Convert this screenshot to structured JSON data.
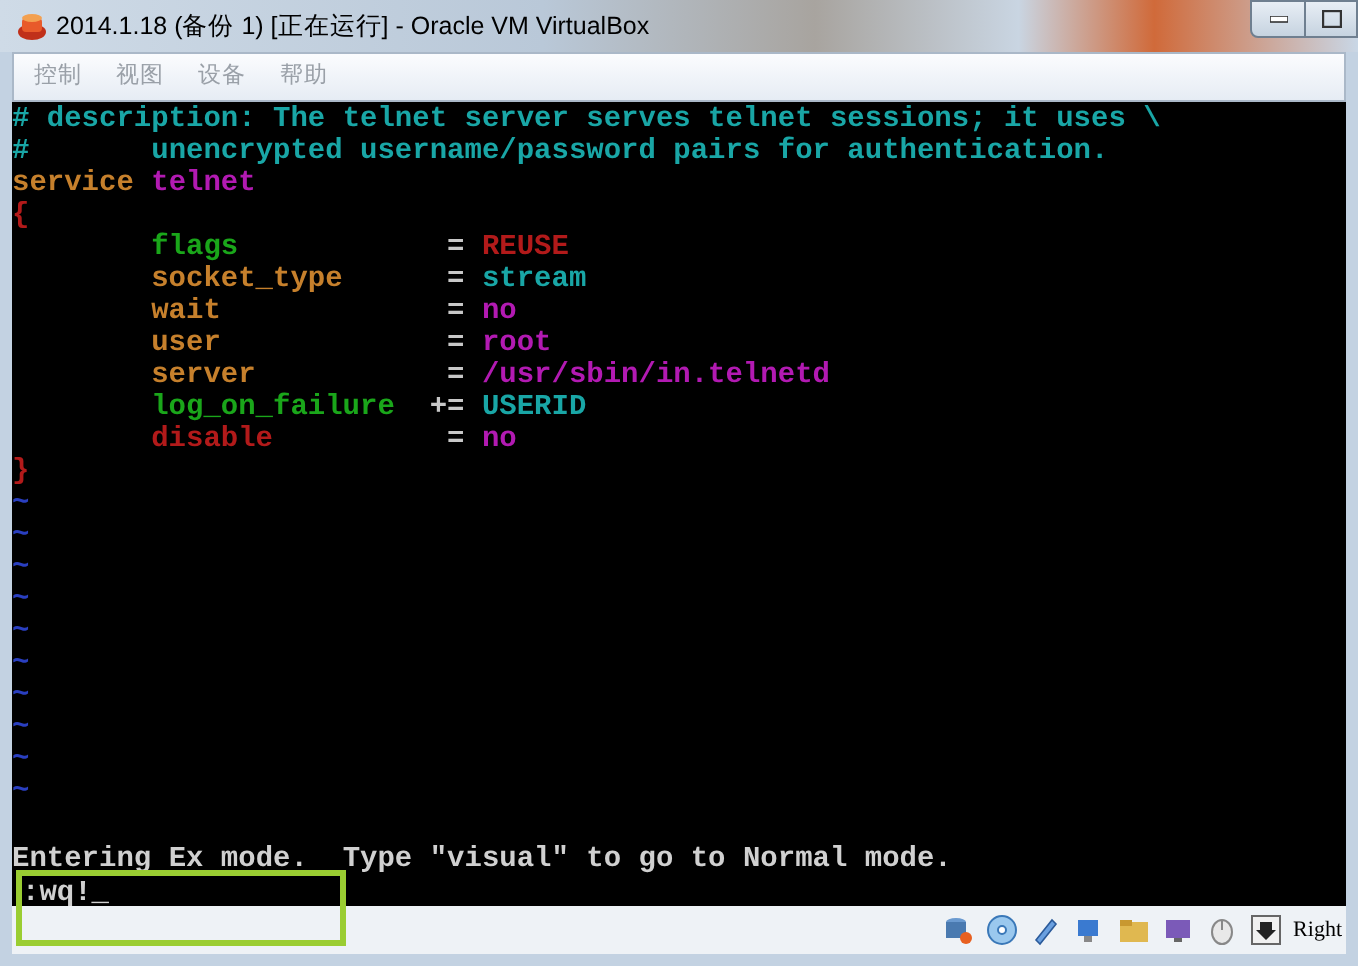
{
  "window": {
    "title": "2014.1.18 (备份 1) [正在运行] - Oracle VM VirtualBox"
  },
  "menu": [
    "控制",
    "视图",
    "设备",
    "帮助"
  ],
  "terminal": {
    "lines": [
      {
        "indented": false,
        "segments": [
          {
            "text": "# description: The telnet server serves telnet sessions; it uses \\",
            "color": "#19a6a6"
          }
        ]
      },
      {
        "indented": false,
        "segments": [
          {
            "text": "#       unencrypted username/password pairs for authentication.",
            "color": "#19a6a6"
          }
        ]
      },
      {
        "indented": false,
        "segments": [
          {
            "text": "service ",
            "color": "#c6802c"
          },
          {
            "text": "telnet",
            "color": "#b21ab2"
          }
        ]
      },
      {
        "indented": false,
        "segments": [
          {
            "text": "{",
            "color": "#b21a1a"
          }
        ]
      },
      {
        "indented": true,
        "segments": [
          {
            "text": "flags",
            "color": "#1aa61a"
          },
          {
            "text": "            = ",
            "color": "#c8c8c8"
          },
          {
            "text": "REUSE",
            "color": "#b21a1a"
          }
        ]
      },
      {
        "indented": true,
        "segments": [
          {
            "text": "socket_type",
            "color": "#c6802c"
          },
          {
            "text": "      = ",
            "color": "#c8c8c8"
          },
          {
            "text": "stream",
            "color": "#19a6a6"
          }
        ]
      },
      {
        "indented": true,
        "segments": [
          {
            "text": "wait",
            "color": "#c6802c"
          },
          {
            "text": "             = ",
            "color": "#c8c8c8"
          },
          {
            "text": "no",
            "color": "#b21ab2"
          }
        ]
      },
      {
        "indented": true,
        "segments": [
          {
            "text": "user",
            "color": "#c6802c"
          },
          {
            "text": "             = ",
            "color": "#c8c8c8"
          },
          {
            "text": "root",
            "color": "#b21ab2"
          }
        ]
      },
      {
        "indented": true,
        "segments": [
          {
            "text": "server",
            "color": "#c6802c"
          },
          {
            "text": "           = ",
            "color": "#c8c8c8"
          },
          {
            "text": "/usr/sbin/in.telnetd",
            "color": "#b21ab2"
          }
        ]
      },
      {
        "indented": true,
        "segments": [
          {
            "text": "log_on_failure",
            "color": "#1aa61a"
          },
          {
            "text": "  += ",
            "color": "#c8c8c8"
          },
          {
            "text": "USERID",
            "color": "#19a6a6"
          }
        ]
      },
      {
        "indented": true,
        "segments": [
          {
            "text": "disable",
            "color": "#b21a1a"
          },
          {
            "text": "          = ",
            "color": "#c8c8c8"
          },
          {
            "text": "no",
            "color": "#b21ab2"
          }
        ]
      },
      {
        "indented": false,
        "segments": [
          {
            "text": "}",
            "color": "#b21a1a"
          }
        ]
      },
      {
        "indented": false,
        "segments": [
          {
            "text": "~",
            "color": "#2a3fc0"
          }
        ]
      },
      {
        "indented": false,
        "segments": [
          {
            "text": "~",
            "color": "#2a3fc0"
          }
        ]
      },
      {
        "indented": false,
        "segments": [
          {
            "text": "~",
            "color": "#2a3fc0"
          }
        ]
      },
      {
        "indented": false,
        "segments": [
          {
            "text": "~",
            "color": "#2a3fc0"
          }
        ]
      },
      {
        "indented": false,
        "segments": [
          {
            "text": "~",
            "color": "#2a3fc0"
          }
        ]
      },
      {
        "indented": false,
        "segments": [
          {
            "text": "~",
            "color": "#2a3fc0"
          }
        ]
      },
      {
        "indented": false,
        "segments": [
          {
            "text": "~",
            "color": "#2a3fc0"
          }
        ]
      },
      {
        "indented": false,
        "segments": [
          {
            "text": "~",
            "color": "#2a3fc0"
          }
        ]
      },
      {
        "indented": false,
        "segments": [
          {
            "text": "~",
            "color": "#2a3fc0"
          }
        ]
      },
      {
        "indented": false,
        "segments": [
          {
            "text": "~",
            "color": "#2a3fc0"
          }
        ]
      }
    ],
    "message": "Entering Ex mode.  Type \"visual\" to go to Normal mode.",
    "command": ":wq!_"
  },
  "status_bar": {
    "host_key": "Right"
  }
}
